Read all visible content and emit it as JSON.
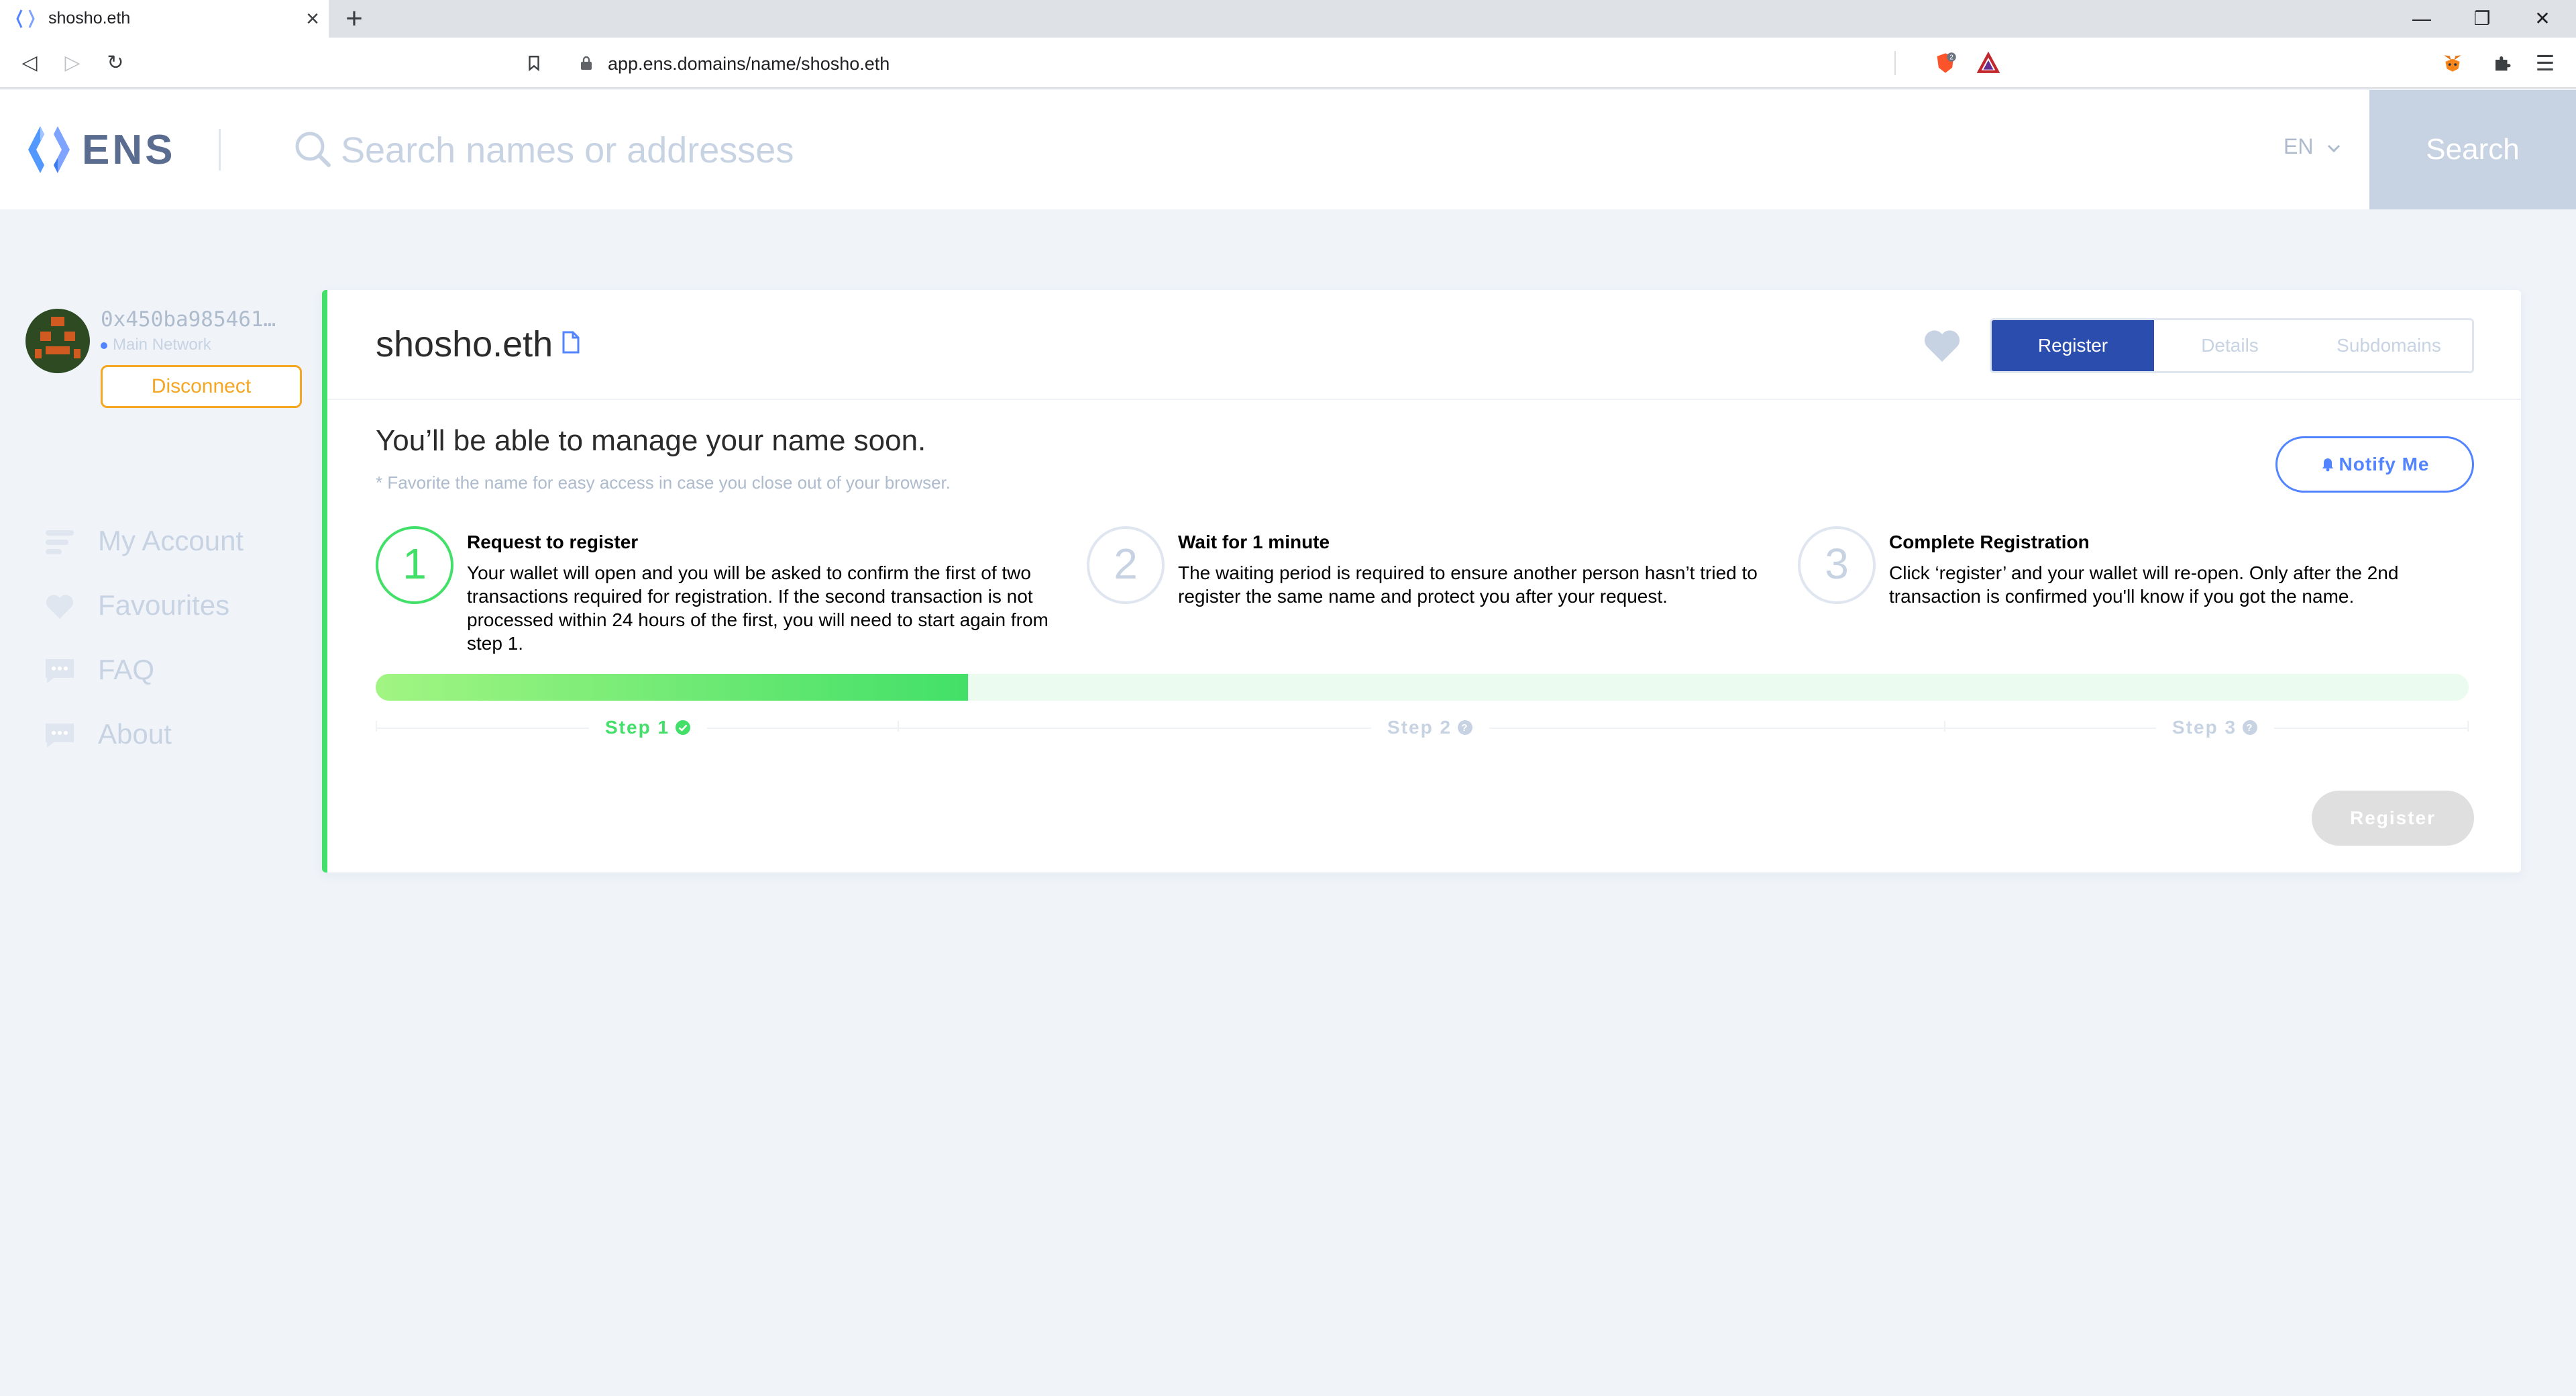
{
  "browser": {
    "tab_title": "shosho.eth",
    "tab_close": "×",
    "new_tab": "+",
    "url": "app.ens.domains/name/shosho.eth",
    "brave_badge": "2"
  },
  "header": {
    "logo_text": "ENS",
    "search_placeholder": "Search names or addresses",
    "language": "EN",
    "search_button": "Search"
  },
  "account": {
    "address": "0x450ba985461…",
    "network": "Main Network",
    "disconnect_label": "Disconnect"
  },
  "sidebar": {
    "items": [
      {
        "label": "My Account",
        "icon": "account-icon"
      },
      {
        "label": "Favourites",
        "icon": "heart-icon"
      },
      {
        "label": "FAQ",
        "icon": "chat-icon"
      },
      {
        "label": "About",
        "icon": "chat-icon"
      }
    ]
  },
  "name_card": {
    "name": "shosho.eth",
    "tabs": [
      {
        "label": "Register",
        "active": true
      },
      {
        "label": "Details",
        "active": false
      },
      {
        "label": "Subdomains",
        "active": false
      }
    ],
    "heading": "You’ll be able to manage your name soon.",
    "note": "* Favorite the name for easy access in case you close out of your browser.",
    "notify_label": "Notify Me",
    "steps": [
      {
        "number": "1",
        "title": "Request to register",
        "description": "Your wallet will open and you will be asked to confirm the first of two transactions required for registration. If the second transaction is not processed within 24 hours of the first, you will need to start again from step 1."
      },
      {
        "number": "2",
        "title": "Wait for 1 minute",
        "description": "The waiting period is required to ensure another person hasn’t tried to register the same name and protect you after your request."
      },
      {
        "number": "3",
        "title": "Complete Registration",
        "description": "Click ‘register’ and your wallet will re-open. Only after the 2nd transaction is confirmed you'll know if you got the name."
      }
    ],
    "progress_fraction": 0.283,
    "step_labels": [
      "Step 1",
      "Step 2",
      "Step 3"
    ],
    "register_label": "Register"
  },
  "colors": {
    "accent_blue": "#2b4dae",
    "link_blue": "#5284ff",
    "success_green": "#42e068",
    "warning_orange": "#f5a623",
    "muted": "#c7d3e3"
  }
}
